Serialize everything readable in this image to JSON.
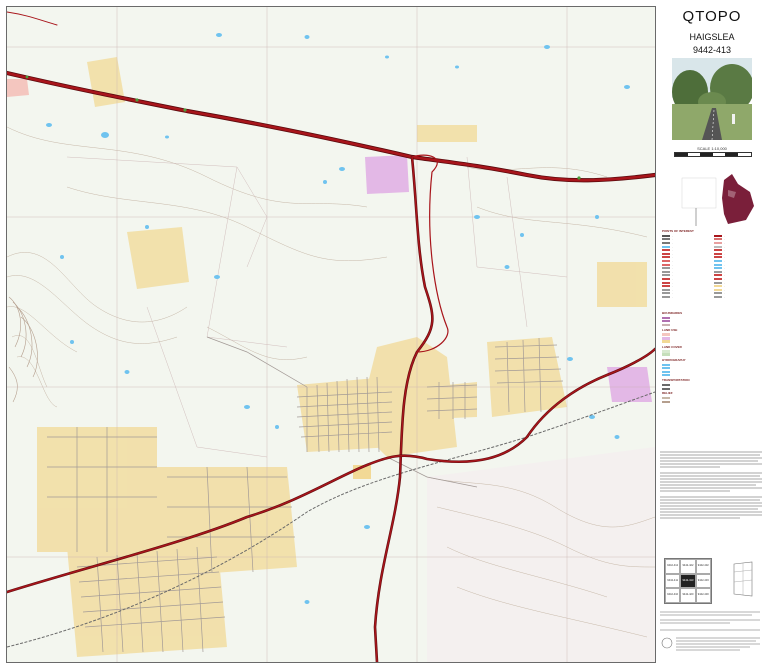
{
  "panel": {
    "brand": "QTOPO",
    "sheet_name": "HAIGSLEA",
    "sheet_number": "9442-413",
    "scale": "SCALE 1:10,000"
  },
  "colors": {
    "highway": "#a8151b",
    "highway_edge": "#5a0a0d",
    "road": "#9c1a22",
    "locality": "#f2d996",
    "urban": "#f4c6bf",
    "reserve": "#e3b8e6",
    "water": "#6fc3ef",
    "background": "#eef4ea",
    "grid": "#c9b1b1",
    "rail": "#6a6a6a"
  },
  "legend": {
    "heads": [
      "POINTS OF INTEREST",
      "ROADS",
      "TRANSPORTATION",
      "BOUNDARIES",
      "LAND USE",
      "LAND COVER",
      "HYDROGRAPHY",
      "RELIEF"
    ]
  },
  "adjoining": {
    "cells": [
      {
        "num": "9442-412",
        "name": "Lower Mt Ms"
      },
      {
        "num": "9442-422",
        "name": "Walloon Pky"
      },
      {
        "num": "9442-432",
        "name": "Marburg"
      },
      {
        "num": "9442-411",
        "name": "Glamorgan"
      },
      {
        "num": "9442-413",
        "name": "HAIGSLEA"
      },
      {
        "num": "9442-433",
        "name": "Walloon"
      },
      {
        "num": "9442-410",
        "name": "Grandchester"
      },
      {
        "num": "9442-420",
        "name": "Calvert"
      },
      {
        "num": "9442-430",
        "name": "Rosewood"
      }
    ]
  }
}
